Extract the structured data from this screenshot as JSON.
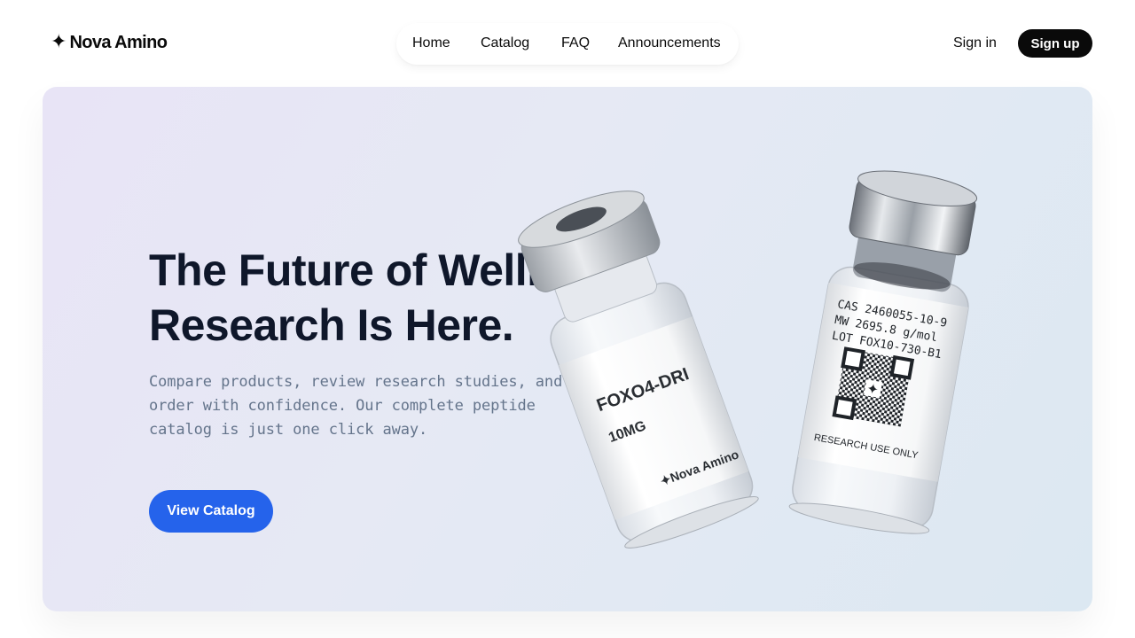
{
  "brand": {
    "name": "Nova Amino",
    "icon": "sparkle-icon"
  },
  "nav": {
    "items": [
      "Home",
      "Catalog",
      "FAQ",
      "Announcements"
    ]
  },
  "auth": {
    "signin": "Sign in",
    "signup": "Sign up"
  },
  "hero": {
    "title_line1": "The Future of Wellness",
    "title_line2": "Research Is Here.",
    "description": "Compare products, review research studies, and order with confidence. Our complete peptide catalog is just one click away.",
    "cta": "View Catalog"
  },
  "vial_left": {
    "name": "FOXO4-DRI",
    "dose": "10MG",
    "brand": "Nova Amino"
  },
  "vial_right": {
    "cas": "CAS 2460055-10-9",
    "mw": "MW 2695.8 g/mol",
    "lot": "LOT FOX10-730-B1",
    "footer": "RESEARCH USE ONLY"
  },
  "colors": {
    "accent": "#2563eb",
    "dark": "#0a0a0a",
    "text": "#0f172a",
    "muted": "#64748b"
  }
}
